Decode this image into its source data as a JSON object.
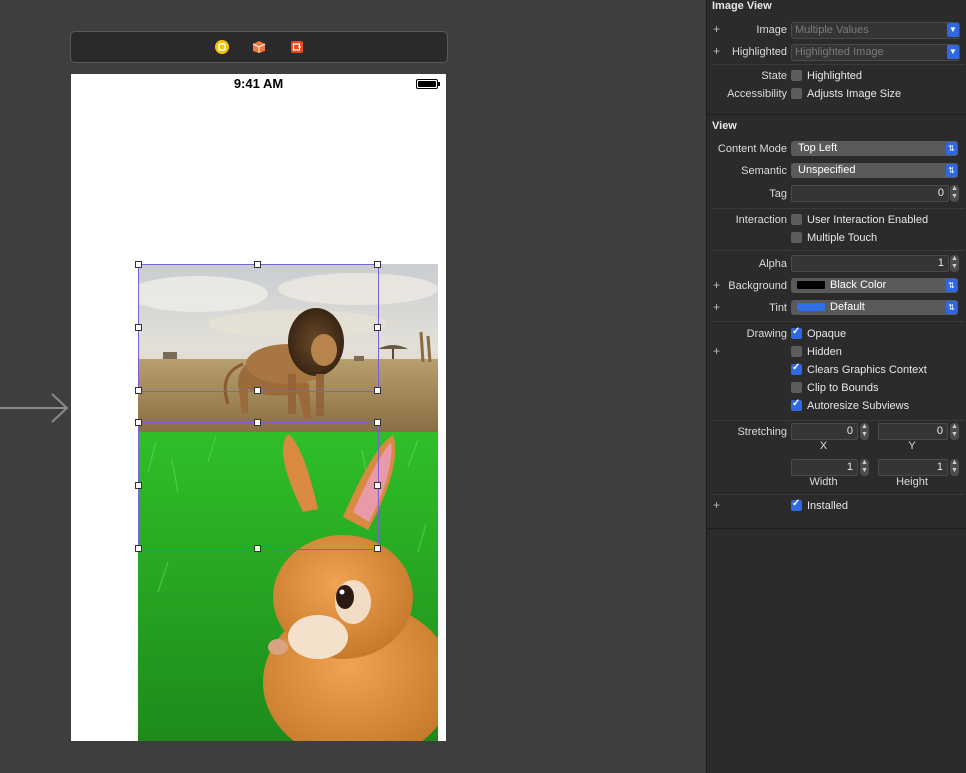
{
  "status_bar": {
    "time": "9:41 AM"
  },
  "dock_icons": [
    "view-controller-icon",
    "first-responder-icon",
    "exit-icon"
  ],
  "colors": {
    "accent": "#2f68e4",
    "selection": "#7b5fd6",
    "canvas": "#3e3e3e",
    "inspector": "#2b2b2b"
  },
  "images": {
    "top": "lion",
    "bottom": "rabbit"
  },
  "image_view": {
    "title": "Image View",
    "image_label": "Image",
    "image_placeholder": "Multiple Values",
    "highlighted_label": "Highlighted",
    "highlighted_placeholder": "Highlighted Image",
    "state_label": "State",
    "state_checkbox": {
      "label": "Highlighted",
      "checked": false
    },
    "accessibility_label": "Accessibility",
    "accessibility_checkbox": {
      "label": "Adjusts Image Size",
      "checked": false
    }
  },
  "view": {
    "title": "View",
    "content_mode_label": "Content Mode",
    "content_mode_value": "Top Left",
    "semantic_label": "Semantic",
    "semantic_value": "Unspecified",
    "tag_label": "Tag",
    "tag_value": "0",
    "interaction_label": "Interaction",
    "user_interaction": {
      "label": "User Interaction Enabled",
      "checked": false
    },
    "multiple_touch": {
      "label": "Multiple Touch",
      "checked": false
    },
    "alpha_label": "Alpha",
    "alpha_value": "1",
    "background_label": "Background",
    "background_value": "Black Color",
    "background_color": "#000000",
    "tint_label": "Tint",
    "tint_value": "Default",
    "tint_color": "#2f6fe6",
    "drawing_label": "Drawing",
    "opaque": {
      "label": "Opaque",
      "checked": true
    },
    "hidden": {
      "label": "Hidden",
      "checked": false
    },
    "clears_graphics": {
      "label": "Clears Graphics Context",
      "checked": true
    },
    "clip_to_bounds": {
      "label": "Clip to Bounds",
      "checked": false
    },
    "autoresize": {
      "label": "Autoresize Subviews",
      "checked": true
    },
    "stretching_label": "Stretching",
    "stretch_x": "0",
    "stretch_y": "0",
    "x_label": "X",
    "y_label": "Y",
    "stretch_width": "1",
    "stretch_height": "1",
    "width_label": "Width",
    "height_label": "Height",
    "installed": {
      "label": "Installed",
      "checked": true
    }
  }
}
